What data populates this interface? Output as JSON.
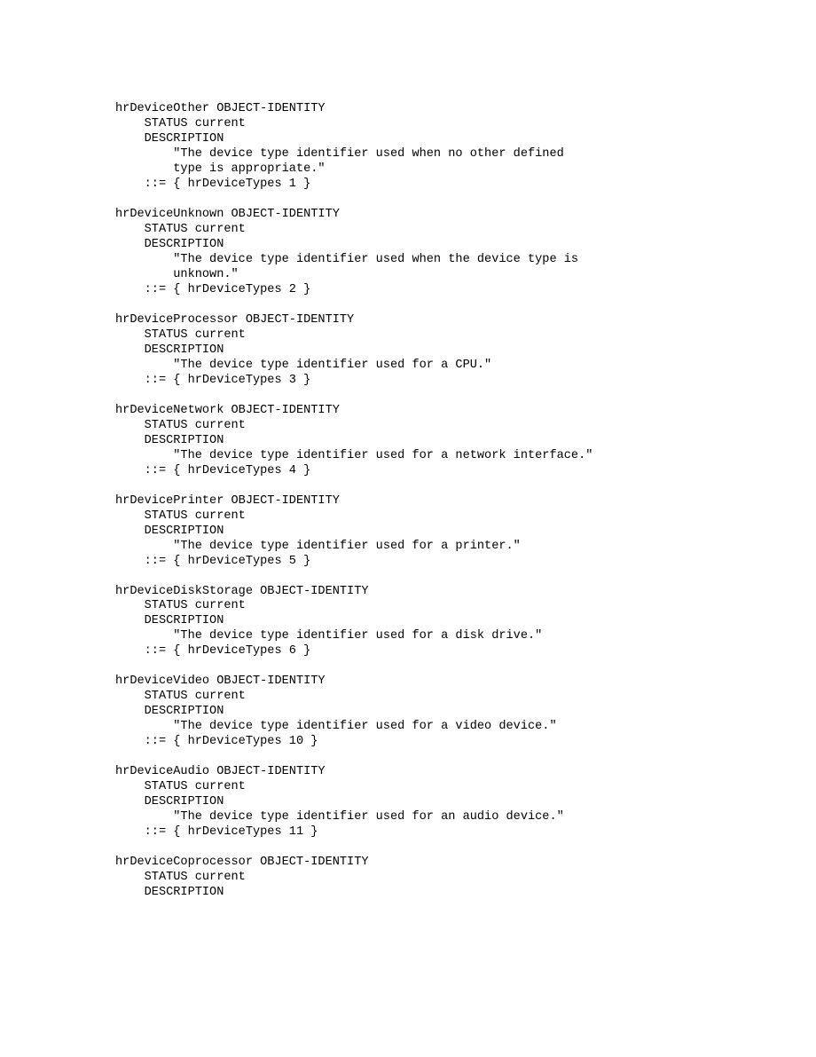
{
  "definitions": [
    {
      "name": "hrDeviceOther",
      "type": "OBJECT-IDENTITY",
      "status": "current",
      "descLines": [
        "\"The device type identifier used when no other defined",
        "type is appropriate.\""
      ],
      "assign": "::= { hrDeviceTypes 1 }"
    },
    {
      "name": "hrDeviceUnknown",
      "type": "OBJECT-IDENTITY",
      "status": "current",
      "descLines": [
        "\"The device type identifier used when the device type is",
        "unknown.\""
      ],
      "assign": "::= { hrDeviceTypes 2 }"
    },
    {
      "name": "hrDeviceProcessor",
      "type": "OBJECT-IDENTITY",
      "status": "current",
      "descLines": [
        "\"The device type identifier used for a CPU.\""
      ],
      "assign": "::= { hrDeviceTypes 3 }"
    },
    {
      "name": "hrDeviceNetwork",
      "type": "OBJECT-IDENTITY",
      "status": "current",
      "descLines": [
        "\"The device type identifier used for a network interface.\""
      ],
      "assign": "::= { hrDeviceTypes 4 }"
    },
    {
      "name": "hrDevicePrinter",
      "type": "OBJECT-IDENTITY",
      "status": "current",
      "descLines": [
        "\"The device type identifier used for a printer.\""
      ],
      "assign": "::= { hrDeviceTypes 5 }"
    },
    {
      "name": "hrDeviceDiskStorage",
      "type": "OBJECT-IDENTITY",
      "status": "current",
      "descLines": [
        "\"The device type identifier used for a disk drive.\""
      ],
      "assign": "::= { hrDeviceTypes 6 }"
    },
    {
      "name": "hrDeviceVideo",
      "type": "OBJECT-IDENTITY",
      "status": "current",
      "descLines": [
        "\"The device type identifier used for a video device.\""
      ],
      "assign": "::= { hrDeviceTypes 10 }"
    },
    {
      "name": "hrDeviceAudio",
      "type": "OBJECT-IDENTITY",
      "status": "current",
      "descLines": [
        "\"The device type identifier used for an audio device.\""
      ],
      "assign": "::= { hrDeviceTypes 11 }"
    },
    {
      "name": "hrDeviceCoprocessor",
      "type": "OBJECT-IDENTITY",
      "status": "current",
      "descLines": [],
      "assign": null
    }
  ],
  "labels": {
    "statusKeyword": "STATUS",
    "descriptionKeyword": "DESCRIPTION"
  }
}
